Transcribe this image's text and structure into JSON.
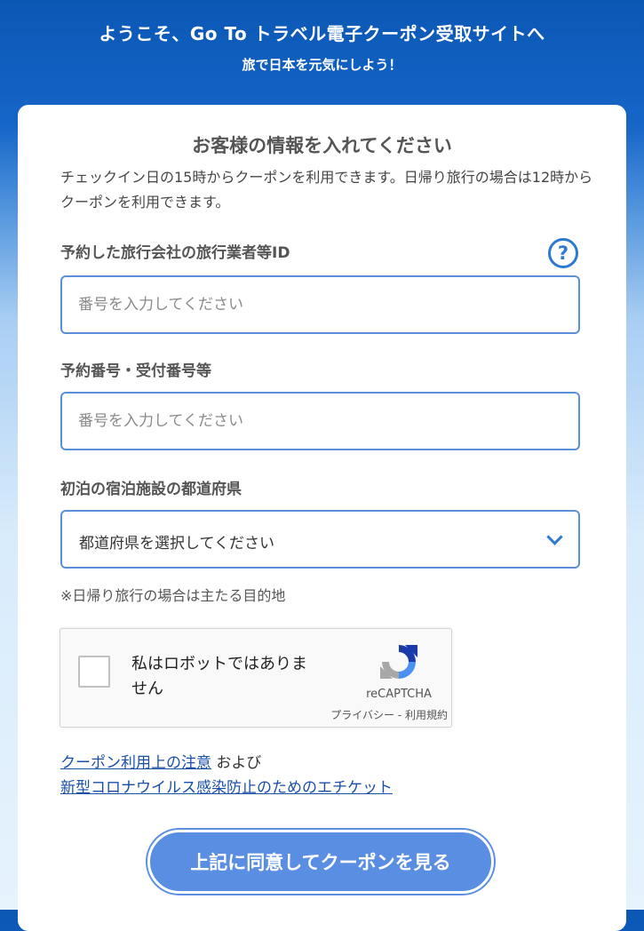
{
  "header": {
    "title": "ようこそ、Go To トラベル電子クーポン受取サイトへ",
    "subtitle": "旅で日本を元気にしよう！"
  },
  "form": {
    "title": "お客様の情報を入れてください",
    "notice": "チェックイン日の15時からクーポンを利用できます。日帰り旅行の場合は12時からクーポンを利用できます。",
    "help_icon": "question-circle-icon",
    "fields": [
      {
        "label": "予約した旅行会社の旅行業者等ID",
        "value": "",
        "placeholder": "番号を入力してください"
      },
      {
        "label": "予約番号・受付番号等",
        "value": "",
        "placeholder": "番号を入力してください"
      }
    ],
    "prefecture": {
      "label": "初泊の宿泊施設の都道府県",
      "selected": "都道府県を選択してください",
      "note": "※日帰り旅行の場合は主たる目的地"
    },
    "recaptcha": {
      "label": "私はロボットではありません",
      "brand": "reCAPTCHA",
      "privacy": "プライバシー",
      "separator": " - ",
      "terms": "利用規約"
    },
    "links": {
      "coupon_notice": "クーポン利用上の注意",
      "conjunction": " および",
      "etiquette": "新型コロナウイルス感染防止のためのエチケット"
    },
    "submit_label": "上記に同意してクーポンを見る"
  },
  "colors": {
    "header_blue": "#0b57b4",
    "accent": "#2e7ad1",
    "button": "#5a8ee2",
    "link": "#1a4fa8"
  }
}
